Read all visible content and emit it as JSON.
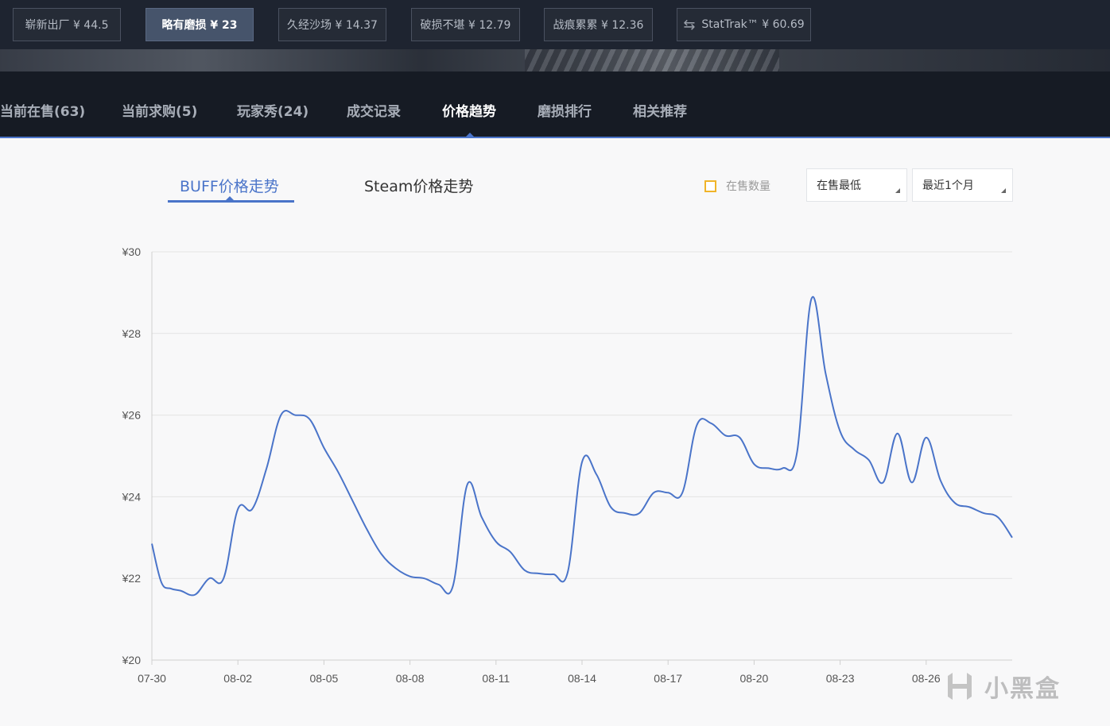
{
  "wear_buttons": [
    {
      "label": "崭新出厂 ¥ 44.5",
      "active": false
    },
    {
      "label": "略有磨损 ¥ 23",
      "active": true
    },
    {
      "label": "久经沙场 ¥ 14.37",
      "active": false
    },
    {
      "label": "破损不堪 ¥ 12.79",
      "active": false
    },
    {
      "label": "战痕累累 ¥ 12.36",
      "active": false
    },
    {
      "label": "StatTrak™ ¥ 60.69",
      "active": false,
      "icon": "swap-arrows-icon"
    }
  ],
  "tabs": [
    {
      "label": "当前在售(63)"
    },
    {
      "label": "当前求购(5)"
    },
    {
      "label": "玩家秀(24)"
    },
    {
      "label": "成交记录"
    },
    {
      "label": "价格趋势",
      "active": true
    },
    {
      "label": "磨损排行"
    },
    {
      "label": "相关推荐"
    }
  ],
  "chart_tabs": {
    "buff": "BUFF价格走势",
    "steam": "Steam价格走势"
  },
  "controls": {
    "show_count_label": "在售数量",
    "price_type": "在售最低",
    "time_range": "最近1个月"
  },
  "colors": {
    "accent": "#4a74c9",
    "checkbox": "#f0b429",
    "line": "#4a74c9"
  },
  "watermark": {
    "text": "小黑盒",
    "icon": "heybox-logo-icon"
  },
  "chart_data": {
    "type": "line",
    "title": "",
    "xlabel": "",
    "ylabel": "",
    "ylim": [
      20,
      30
    ],
    "y_ticks": [
      20,
      22,
      24,
      26,
      28,
      30
    ],
    "y_tick_prefix": "¥",
    "grid": true,
    "x_ticks": [
      "07-30",
      "08-02",
      "08-05",
      "08-08",
      "08-11",
      "08-14",
      "08-17",
      "08-20",
      "08-23",
      "08-26"
    ],
    "x_range": [
      "07-30",
      "08-29"
    ],
    "series": [
      {
        "name": "",
        "points": [
          [
            "07-30",
            22.85
          ],
          [
            "07-30 08h",
            21.9
          ],
          [
            "07-30 16h",
            21.75
          ],
          [
            "07-31",
            21.7
          ],
          [
            "07-31 12h",
            21.6
          ],
          [
            "08-01",
            22.0
          ],
          [
            "08-01 12h",
            22.0
          ],
          [
            "08-02",
            23.7
          ],
          [
            "08-02 12h",
            23.7
          ],
          [
            "08-03",
            24.7
          ],
          [
            "08-03 12h",
            26.0
          ],
          [
            "08-04",
            26.0
          ],
          [
            "08-04 12h",
            25.9
          ],
          [
            "08-05",
            25.2
          ],
          [
            "08-05 12h",
            24.6
          ],
          [
            "08-06",
            23.9
          ],
          [
            "08-06 12h",
            23.2
          ],
          [
            "08-07",
            22.6
          ],
          [
            "08-07 12h",
            22.25
          ],
          [
            "08-08",
            22.05
          ],
          [
            "08-08 12h",
            22.0
          ],
          [
            "08-09",
            21.85
          ],
          [
            "08-09 12h",
            21.82
          ],
          [
            "08-10",
            24.3
          ],
          [
            "08-10 12h",
            23.5
          ],
          [
            "08-11",
            22.9
          ],
          [
            "08-11 12h",
            22.65
          ],
          [
            "08-12",
            22.2
          ],
          [
            "08-12 12h",
            22.12
          ],
          [
            "08-13",
            22.1
          ],
          [
            "08-13 12h",
            22.15
          ],
          [
            "08-14",
            24.85
          ],
          [
            "08-14 12h",
            24.55
          ],
          [
            "08-15",
            23.75
          ],
          [
            "08-15 12h",
            23.6
          ],
          [
            "08-16",
            23.6
          ],
          [
            "08-16 12h",
            24.1
          ],
          [
            "08-17",
            24.1
          ],
          [
            "08-17 12h",
            24.1
          ],
          [
            "08-18",
            25.75
          ],
          [
            "08-18 12h",
            25.8
          ],
          [
            "08-19",
            25.5
          ],
          [
            "08-19 12h",
            25.45
          ],
          [
            "08-20",
            24.8
          ],
          [
            "08-20 12h",
            24.7
          ],
          [
            "08-21",
            24.7
          ],
          [
            "08-21 12h",
            25.1
          ],
          [
            "08-22",
            28.85
          ],
          [
            "08-22 12h",
            27.0
          ],
          [
            "08-23",
            25.6
          ],
          [
            "08-23 12h",
            25.15
          ],
          [
            "08-24",
            24.9
          ],
          [
            "08-24 12h",
            24.35
          ],
          [
            "08-25",
            25.55
          ],
          [
            "08-25 12h",
            24.35
          ],
          [
            "08-26",
            25.45
          ],
          [
            "08-26 12h",
            24.4
          ],
          [
            "08-27",
            23.85
          ],
          [
            "08-27 12h",
            23.75
          ],
          [
            "08-28",
            23.6
          ],
          [
            "08-28 12h",
            23.5
          ],
          [
            "08-29",
            23.0
          ]
        ]
      }
    ]
  }
}
